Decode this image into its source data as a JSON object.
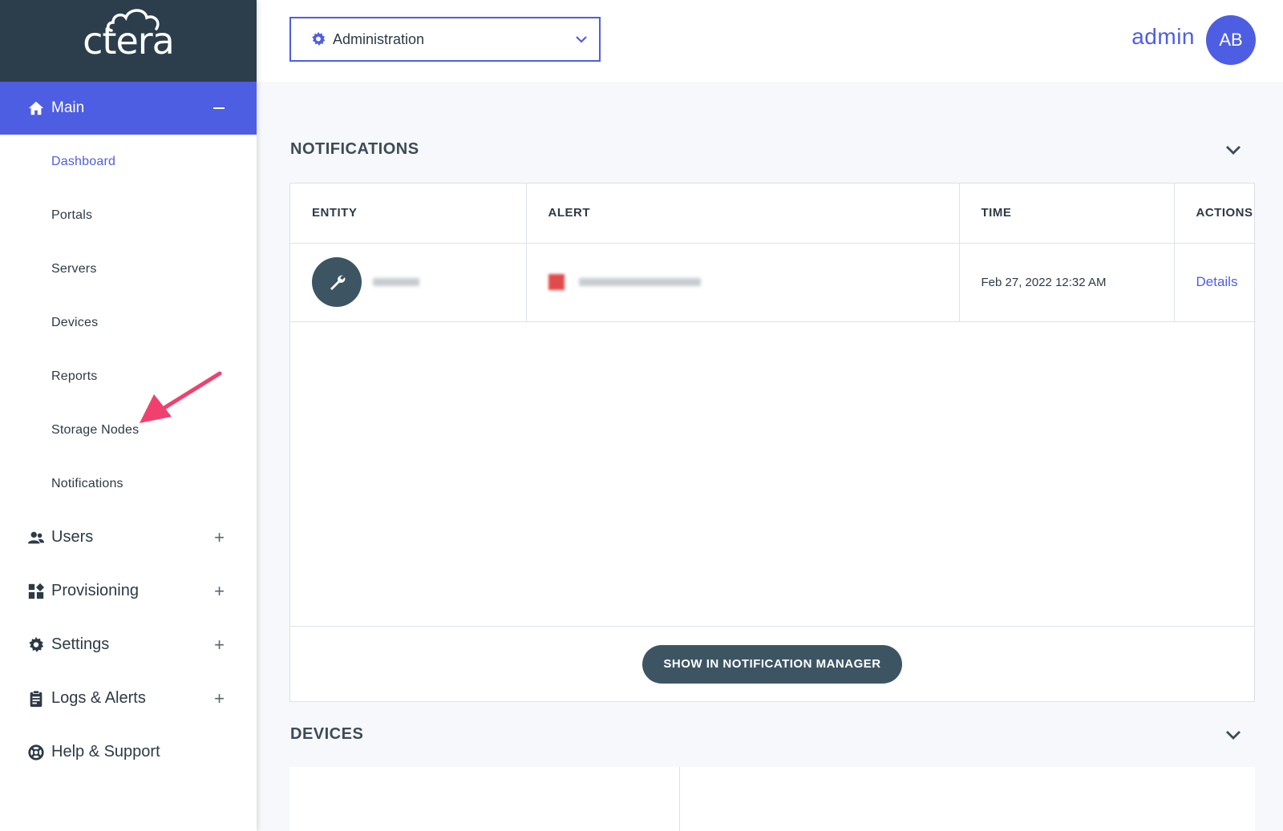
{
  "brand": {
    "logo_text": "ctera"
  },
  "sidebar": {
    "main": {
      "label": "Main",
      "icon": "home-icon"
    },
    "sub_items": [
      {
        "label": "Dashboard",
        "active": true
      },
      {
        "label": "Portals"
      },
      {
        "label": "Servers"
      },
      {
        "label": "Devices"
      },
      {
        "label": "Reports"
      },
      {
        "label": "Storage Nodes"
      },
      {
        "label": "Notifications"
      }
    ],
    "groups": [
      {
        "label": "Users",
        "icon": "users-icon",
        "expand": "+"
      },
      {
        "label": "Provisioning",
        "icon": "provisioning-icon",
        "expand": "+"
      },
      {
        "label": "Settings",
        "icon": "gear-icon",
        "expand": "+"
      },
      {
        "label": "Logs & Alerts",
        "icon": "clipboard-icon",
        "expand": "+"
      },
      {
        "label": "Help & Support",
        "icon": "lifebuoy-icon"
      }
    ]
  },
  "topbar": {
    "context_value": "Administration",
    "user_name": "admin",
    "avatar_initials": "AB"
  },
  "notifications": {
    "title": "NOTIFICATIONS",
    "columns": [
      "ENTITY",
      "ALERT",
      "TIME",
      "ACTIONS"
    ],
    "rows": [
      {
        "time": "Feb 27, 2022 12:32 AM",
        "action": "Details"
      }
    ],
    "button_label": "SHOW IN NOTIFICATION MANAGER"
  },
  "devices": {
    "title": "DEVICES"
  },
  "colors": {
    "accent": "#4d5ee3",
    "sidebar_header": "#2c3e4c",
    "button": "#3d5563",
    "annotation": "#f0416e"
  }
}
